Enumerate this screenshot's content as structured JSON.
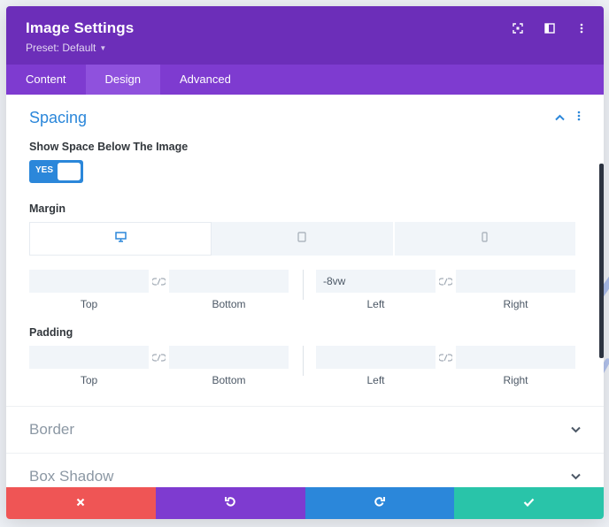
{
  "header": {
    "title": "Image Settings",
    "preset": "Preset: Default",
    "icons": [
      "focus-icon",
      "columns-icon",
      "more-icon"
    ]
  },
  "tabs": [
    {
      "label": "Content"
    },
    {
      "label": "Design",
      "active": true
    },
    {
      "label": "Advanced"
    }
  ],
  "spacing": {
    "title": "Spacing",
    "show_space_label": "Show Space Below The Image",
    "toggle_text": "YES",
    "margin_label": "Margin",
    "padding_label": "Padding",
    "devices": [
      "desktop-icon",
      "tablet-icon",
      "phone-icon"
    ],
    "margin": {
      "top": {
        "label": "Top",
        "value": ""
      },
      "bottom": {
        "label": "Bottom",
        "value": ""
      },
      "left": {
        "label": "Left",
        "value": "-8vw"
      },
      "right": {
        "label": "Right",
        "value": ""
      }
    },
    "padding": {
      "top": {
        "label": "Top",
        "value": ""
      },
      "bottom": {
        "label": "Bottom",
        "value": ""
      },
      "left": {
        "label": "Left",
        "value": ""
      },
      "right": {
        "label": "Right",
        "value": ""
      }
    }
  },
  "sections": [
    {
      "title": "Border"
    },
    {
      "title": "Box Shadow"
    }
  ],
  "colors": {
    "header": "#6c2eb9",
    "tabs": "#7e3bd0",
    "accent": "#2b87da",
    "cancel": "#ef5555",
    "undo": "#7e3bd0",
    "redo": "#2b87da",
    "save": "#29c4a9"
  },
  "footer": [
    "close-icon",
    "undo-icon",
    "redo-icon",
    "check-icon"
  ]
}
